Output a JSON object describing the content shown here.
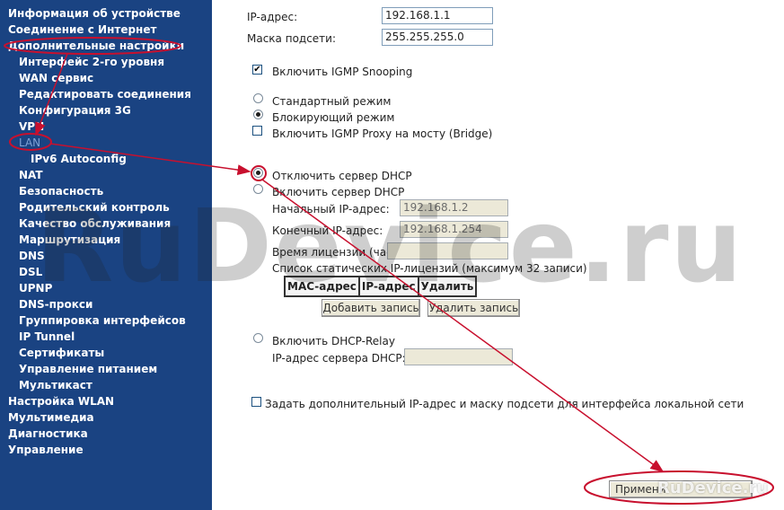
{
  "sidebar": {
    "items": [
      {
        "label": "Информация об устройстве"
      },
      {
        "label": "Соединение с Интернет"
      },
      {
        "label": "Дополнительные настройки"
      },
      {
        "label": "Интерфейс 2-го уровня"
      },
      {
        "label": "WAN сервис"
      },
      {
        "label": "Редактировать соединения"
      },
      {
        "label": "Конфигурация 3G"
      },
      {
        "label": "VPN"
      },
      {
        "label": "LAN"
      },
      {
        "label": "IPv6 Autoconfig"
      },
      {
        "label": "NAT"
      },
      {
        "label": "Безопасность"
      },
      {
        "label": "Родительский контроль"
      },
      {
        "label": "Качество обслуживания"
      },
      {
        "label": "Маршрутизация"
      },
      {
        "label": "DNS"
      },
      {
        "label": "DSL"
      },
      {
        "label": "UPNP"
      },
      {
        "label": "DNS-прокси"
      },
      {
        "label": "Группировка интерфейсов"
      },
      {
        "label": "IP Tunnel"
      },
      {
        "label": "Сертификаты"
      },
      {
        "label": "Управление питанием"
      },
      {
        "label": "Мультикаст"
      },
      {
        "label": "Настройка WLAN"
      },
      {
        "label": "Мультимедиа"
      },
      {
        "label": "Диагностика"
      },
      {
        "label": "Управление"
      }
    ]
  },
  "lan": {
    "ip_label": "IP-адрес:",
    "ip_value": "192.168.1.1",
    "mask_label": "Маска подсети:",
    "mask_value": "255.255.255.0",
    "igmp_snooping_label": "Включить IGMP Snooping",
    "standard_mode_label": "Стандартный режим",
    "blocking_mode_label": "Блокирующий режим",
    "igmp_proxy_label": "Включить IGMP Proxy на мосту (Bridge)"
  },
  "dhcp": {
    "disable_label": "Отключить сервер DHCP",
    "enable_label": "Включить сервер DHCP",
    "start_ip_label": "Начальный IP-адрес:",
    "start_ip_value": "192.168.1.2",
    "end_ip_label": "Конечный IP-адрес:",
    "end_ip_value": "192.168.1.254",
    "lease_label": "Время лицензии (часы):",
    "lease_value": "",
    "static_list_label": "Список статических IP-лицензий (максимум 32 записи)",
    "table_headers": [
      "MAC-адрес",
      "IP-адрес",
      "Удалить"
    ],
    "add_button": "Добавить запись",
    "remove_button": "Удалить запись",
    "relay_label": "Включить DHCP-Relay",
    "relay_server_label": "IP-адрес сервера DHCP:",
    "relay_server_value": ""
  },
  "extra_ip_label": "Задать дополнительный IP-адрес и маску подсети для интерфейса локальной сети",
  "apply_button": "Примени",
  "watermark": "RuDevice.ru",
  "watermark_small": "RuDevice.ru",
  "colors": {
    "sidebar_bg": "#1a4382",
    "annotation_red": "#c8102e"
  }
}
